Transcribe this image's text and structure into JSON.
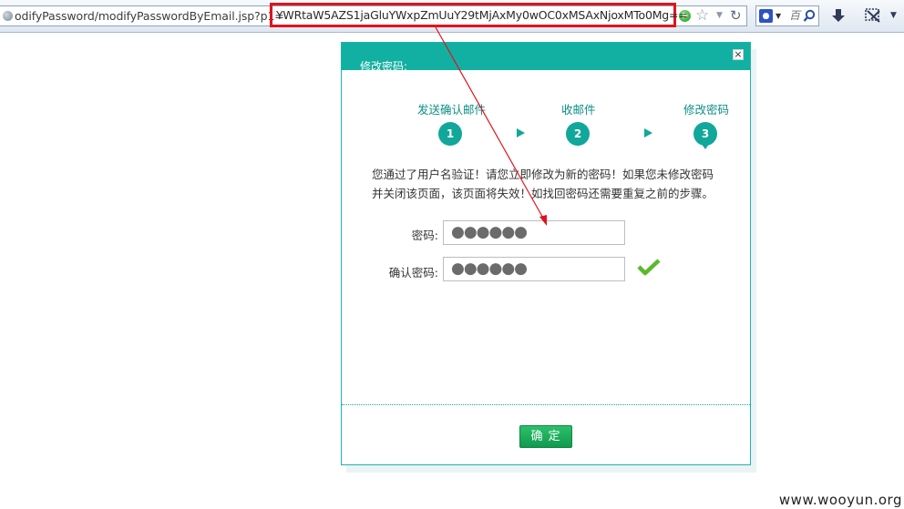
{
  "browser": {
    "url_prefix": "odifyPassword/modifyPasswordByEmail.jsp?p1=",
    "url_highlighted": "YWRtaW5AZS1jaGluYWxpZmUuY29tMjAxMy0wOC0xMSAxNjoxMTo0Mg=="
  },
  "dialog": {
    "title": "修改密码:",
    "close": "×",
    "steps": [
      {
        "label": "发送确认邮件",
        "number": "1"
      },
      {
        "label": "收邮件",
        "number": "2"
      },
      {
        "label": "修改密码",
        "number": "3"
      }
    ],
    "notice": "您通过了用户名验证！请您立即修改为新的密码！如果您未修改密码并关闭该页面，该页面将失效！如找回密码还需要重复之前的步骤。",
    "password_label": "密码:",
    "password_value": "●●●●●●",
    "confirm_label": "确认密码:",
    "confirm_value": "●●●●●●",
    "submit": "确定"
  },
  "watermark": "www.wooyun.org",
  "colors": {
    "accent": "#12b0a2",
    "button": "#119a4f",
    "annotation": "#e0141c"
  }
}
